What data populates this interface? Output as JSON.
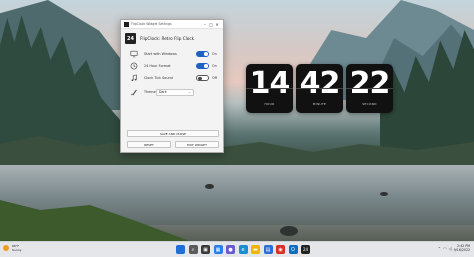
{
  "settings_window": {
    "title": "FlipClock Widget Settings",
    "app_name": "FlipClock: Retro Flip Clock",
    "app_logo": "24",
    "controls": {
      "minimize": "–",
      "maximize": "□",
      "close": "✕"
    },
    "settings": [
      {
        "icon": "monitor-icon",
        "label": "Start with Windows",
        "state": "On",
        "enabled": true
      },
      {
        "icon": "clock-icon",
        "label": "24 Hour Format",
        "state": "On",
        "enabled": true
      },
      {
        "icon": "music-note-icon",
        "label": "Clock Tick Sound",
        "state": "Off",
        "enabled": false
      }
    ],
    "theme": {
      "label": "Theme",
      "value": "Dark",
      "icon": "palette-icon"
    },
    "save_label": "SAVE AND CLOSE",
    "reset_label": "RESET",
    "exit_label": "EXIT WIDGET"
  },
  "flip_clock": [
    {
      "digits": "14",
      "label": "HOUR"
    },
    {
      "digits": "42",
      "label": "MINUTE"
    },
    {
      "digits": "22",
      "label": "SECOND"
    }
  ],
  "taskbar": {
    "weather": {
      "temp": "66°F",
      "condition": "Sunny"
    },
    "apps": [
      {
        "name": "start-icon",
        "glyph": "",
        "color": "#1f6fd6"
      },
      {
        "name": "search-icon",
        "glyph": "⌕",
        "color": "#5b5b5b"
      },
      {
        "name": "task-view-icon",
        "glyph": "▣",
        "color": "#3a3a3a"
      },
      {
        "name": "widgets-icon",
        "glyph": "▦",
        "color": "#2b7de9"
      },
      {
        "name": "chat-icon",
        "glyph": "●",
        "color": "#6a5acd"
      },
      {
        "name": "edge-icon",
        "glyph": "e",
        "color": "#1b8ed0"
      },
      {
        "name": "file-explorer-icon",
        "glyph": "▬",
        "color": "#f2b600"
      },
      {
        "name": "store-icon",
        "glyph": "▤",
        "color": "#2d6fd1"
      },
      {
        "name": "chrome-icon",
        "glyph": "◉",
        "color": "#d93025"
      },
      {
        "name": "outlook-icon",
        "glyph": "O",
        "color": "#0f6cbd"
      },
      {
        "name": "flipclock-app-icon",
        "glyph": "24",
        "color": "#222222"
      }
    ],
    "time": "2:42 PM",
    "date": "9/16/2022"
  }
}
